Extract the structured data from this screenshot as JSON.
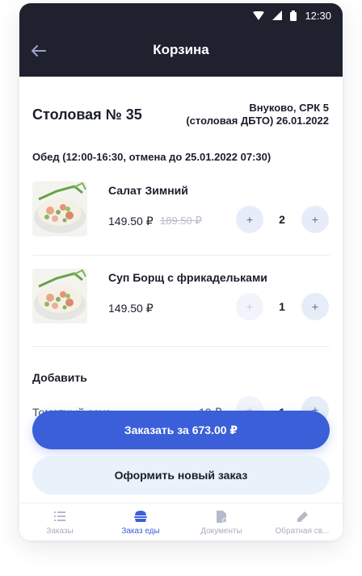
{
  "status": {
    "time": "12:30"
  },
  "header": {
    "title": "Корзина",
    "back_icon": "arrow-left-icon"
  },
  "cafe": {
    "name": "Столовая № 35",
    "address_line1": "Внуково, СРК 5",
    "address_line2": "(столовая ДБТО) 26.01.2022"
  },
  "meal": {
    "title": "Обед (12:00-16:30, отмена до 25.01.2022 07:30)"
  },
  "items": [
    {
      "name": "Салат Зимний",
      "price": "149.50 ₽",
      "old_price": "189.50 ₽",
      "quantity": "2",
      "minus_label": "+",
      "plus_label": "+"
    },
    {
      "name": "Суп Борщ с фрикадельками",
      "price": "149.50 ₽",
      "old_price": "",
      "quantity": "1",
      "minus_label": "+",
      "plus_label": "+"
    }
  ],
  "addons": {
    "title": "Добавить",
    "items": [
      {
        "name": "Томатный соус",
        "price": "10 ₽",
        "quantity": "1"
      }
    ]
  },
  "actions": {
    "order_label": "Заказать за 673.00 ₽",
    "new_order_label": "Оформить новый заказ"
  },
  "bottom_nav": [
    {
      "label": "Заказы",
      "icon": "list-icon",
      "active": false
    },
    {
      "label": "Заказ еды",
      "icon": "burger-icon",
      "active": true
    },
    {
      "label": "Документы",
      "icon": "document-icon",
      "active": false
    },
    {
      "label": "Обратная св...",
      "icon": "pencil-icon",
      "active": false
    }
  ],
  "colors": {
    "accent": "#3a5fd8",
    "header_bg": "#20212f",
    "button_light": "#e7edf8"
  }
}
